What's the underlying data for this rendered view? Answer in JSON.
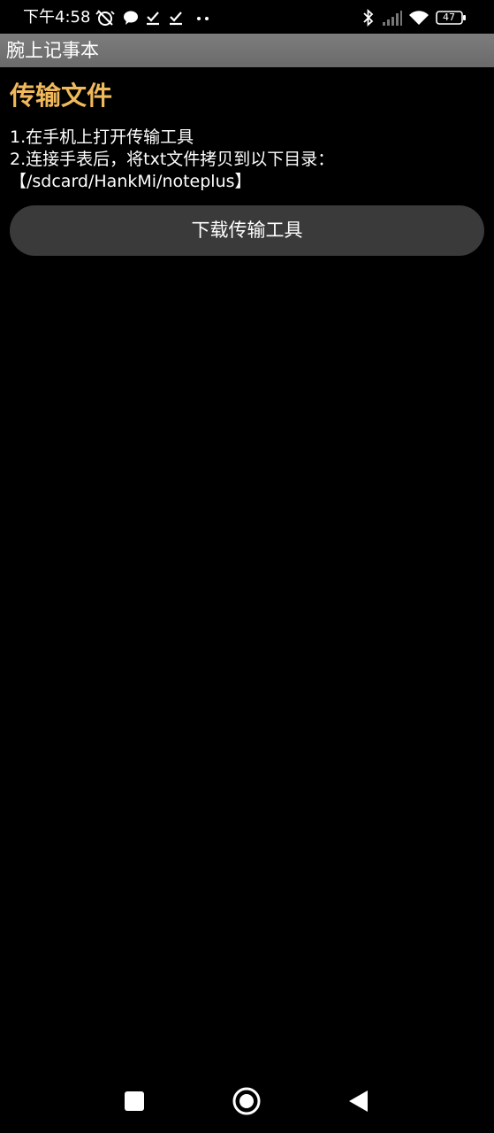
{
  "status_bar": {
    "time": "下午4:58",
    "battery_level": "47",
    "icons": [
      "alarm-off-icon",
      "chat-bubble-icon",
      "task-check-icon",
      "task-check-icon",
      "more-dots-icon",
      "bluetooth-icon",
      "cellular-signal-icon",
      "wifi-icon",
      "battery-icon"
    ]
  },
  "app_bar": {
    "title": "腕上记事本"
  },
  "content": {
    "heading": "传输文件",
    "instructions": [
      "1.在手机上打开传输工具",
      "2.连接手表后，将txt文件拷贝到以下目录：",
      "【/sdcard/HankMi/noteplus】"
    ],
    "download_button_label": "下载传输工具"
  },
  "colors": {
    "heading": "#f0b95b",
    "app_bar": "#737373",
    "button_bg": "#3a3a3a",
    "background": "#000000"
  },
  "nav_bar": {
    "buttons": [
      "recents-square-icon",
      "home-circle-icon",
      "back-triangle-icon"
    ]
  }
}
